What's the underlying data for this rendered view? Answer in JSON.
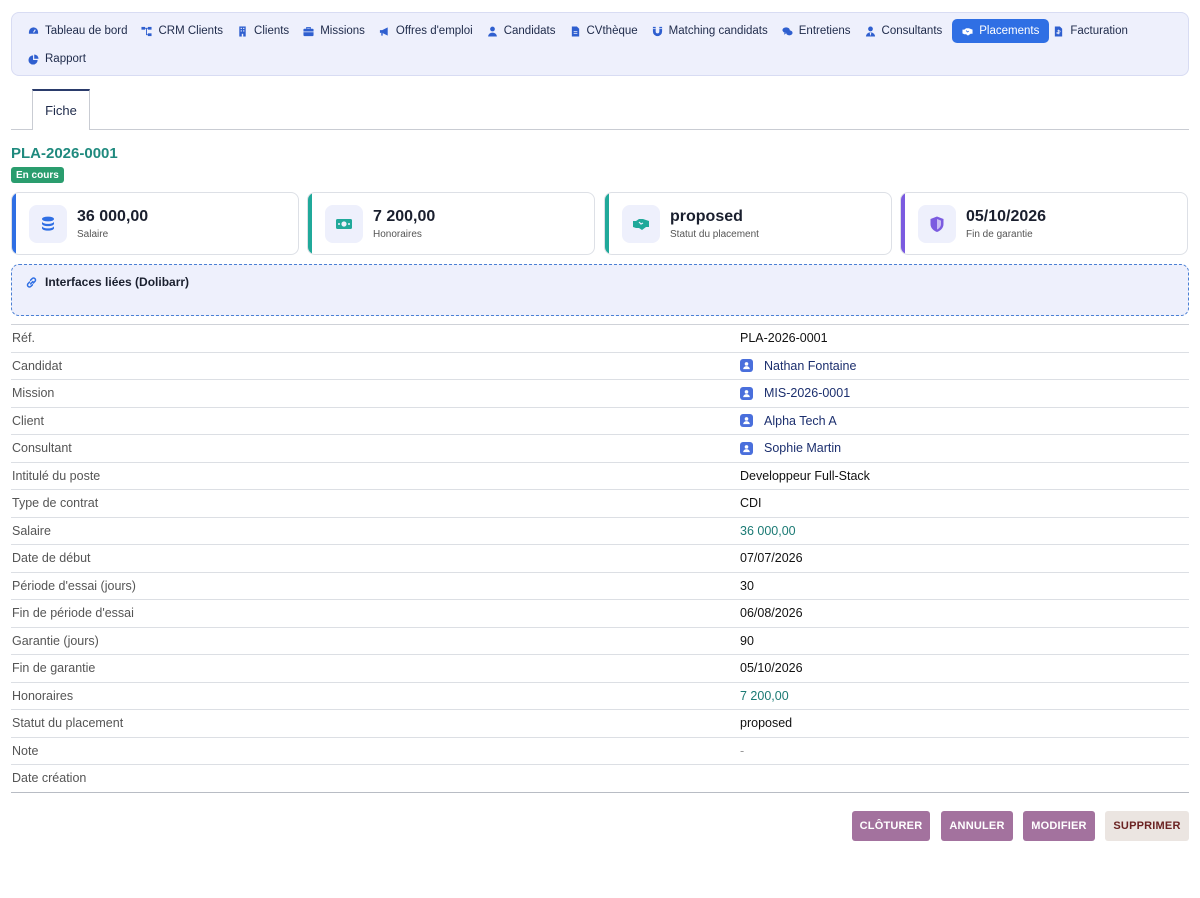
{
  "nav": {
    "row1": [
      {
        "label": "Tableau de bord",
        "icon": "dashboard-icon"
      },
      {
        "label": "CRM Clients",
        "icon": "sitemap-icon"
      },
      {
        "label": "Clients",
        "icon": "building-icon"
      },
      {
        "label": "Missions",
        "icon": "briefcase-icon"
      },
      {
        "label": "Offres d'emploi",
        "icon": "megaphone-icon"
      },
      {
        "label": "Candidats",
        "icon": "user-icon"
      },
      {
        "label": "CVthèque",
        "icon": "file-icon"
      },
      {
        "label": "Matching candidats",
        "icon": "magnet-icon"
      },
      {
        "label": "Entretiens",
        "icon": "comments-icon"
      },
      {
        "label": "Consultants",
        "icon": "user-tie-icon"
      },
      {
        "label": "Placements",
        "icon": "handshake-icon",
        "active": true
      },
      {
        "label": "Facturation",
        "icon": "invoice-icon"
      }
    ],
    "row2": [
      {
        "label": "Rapport",
        "icon": "pie-chart-icon"
      }
    ]
  },
  "tabs": {
    "fiche": "Fiche"
  },
  "record": {
    "ref": "PLA-2026-0001",
    "status_badge": "En cours"
  },
  "kpis": [
    {
      "value": "36 000,00",
      "label": "Salaire",
      "icon": "coins-icon",
      "accent": "#2f6fe4"
    },
    {
      "value": "7 200,00",
      "label": "Honoraires",
      "icon": "banknote-icon",
      "accent": "#20a99a"
    },
    {
      "value": "proposed",
      "label": "Statut du placement",
      "icon": "handshake-icon",
      "accent": "#20a99a"
    },
    {
      "value": "05/10/2026",
      "label": "Fin de garantie",
      "icon": "shield-icon",
      "accent": "#7b5be0"
    }
  ],
  "linked": {
    "title": "Interfaces liées (Dolibarr)"
  },
  "fields": [
    {
      "label": "Réf.",
      "value": "PLA-2026-0001"
    },
    {
      "label": "Candidat",
      "value": "Nathan Fontaine",
      "kind": "link"
    },
    {
      "label": "Mission",
      "value": "MIS-2026-0001",
      "kind": "link"
    },
    {
      "label": "Client",
      "value": "Alpha Tech A",
      "kind": "link"
    },
    {
      "label": "Consultant",
      "value": "Sophie Martin",
      "kind": "link"
    },
    {
      "label": "Intitulé du poste",
      "value": "Developpeur Full-Stack"
    },
    {
      "label": "Type de contrat",
      "value": "CDI"
    },
    {
      "label": "Salaire",
      "value": "36 000,00",
      "kind": "money"
    },
    {
      "label": "Date de début",
      "value": "07/07/2026"
    },
    {
      "label": "Période d'essai (jours)",
      "value": "30"
    },
    {
      "label": "Fin de période d'essai",
      "value": "06/08/2026"
    },
    {
      "label": "Garantie (jours)",
      "value": "90"
    },
    {
      "label": "Fin de garantie",
      "value": "05/10/2026"
    },
    {
      "label": "Honoraires",
      "value": "7 200,00",
      "kind": "money"
    },
    {
      "label": "Statut du placement",
      "value": "proposed"
    },
    {
      "label": "Note",
      "value": "-",
      "kind": "muted"
    },
    {
      "label": "Date création",
      "value": ""
    }
  ],
  "actions": {
    "close": "CLÔTURER",
    "cancel": "ANNULER",
    "edit": "MODIFIER",
    "delete": "SUPPRIMER"
  }
}
